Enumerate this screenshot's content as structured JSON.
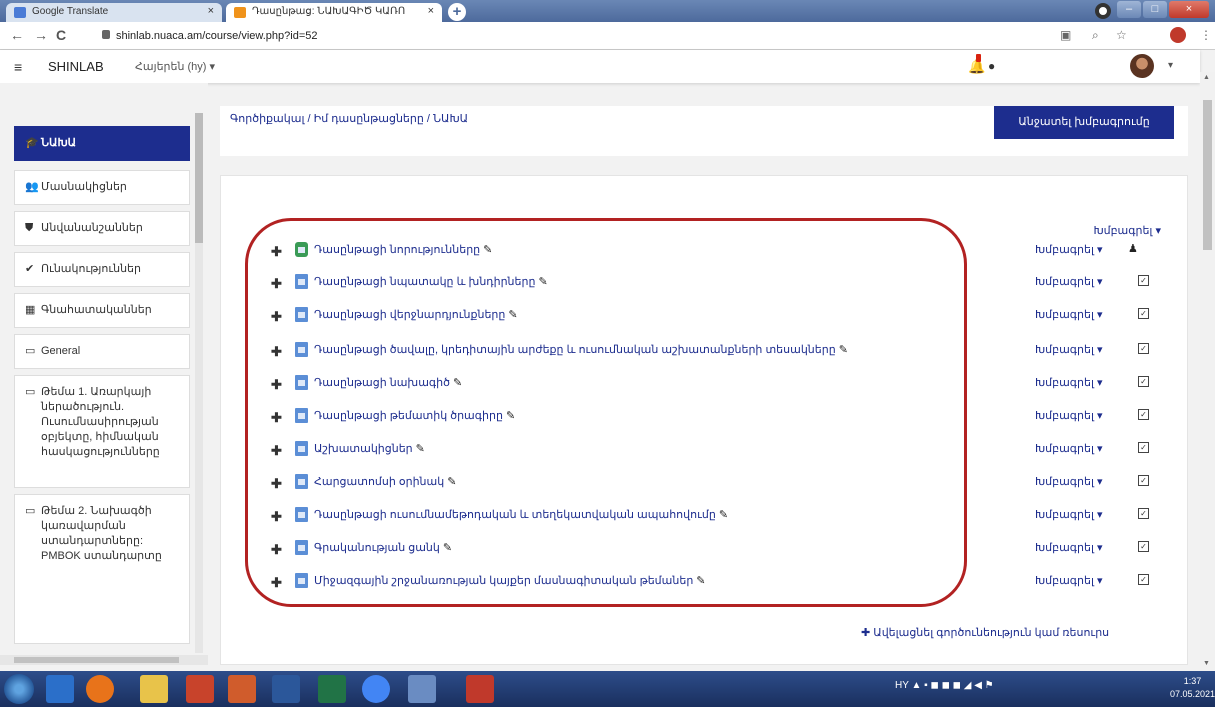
{
  "browser": {
    "tabs": [
      {
        "label": "Google Translate",
        "close": "×",
        "favicon_color": "#4a7bd6"
      },
      {
        "label": "Դասընթաց: ՆԱԽԱԳԻԾ ԿԱՌՈ",
        "close": "×",
        "favicon_color": "#f0931b"
      }
    ],
    "new_tab": "+",
    "window_buttons": [
      "–",
      "□",
      "×"
    ],
    "url": "shinlab.nuaca.am/course/view.php?id=52",
    "nav": {
      "back": "←",
      "forward": "→",
      "reload": "C"
    }
  },
  "navbar": {
    "brand": "SHINLAB",
    "language": "Հայերեն (hy) ▾",
    "menu_icon": "≡",
    "avatar_caret": "▾"
  },
  "drawer": {
    "items": [
      {
        "icon": "graduation-cap-icon",
        "glyph": "🎓",
        "label": "ՆԱԽԱ",
        "active": true
      },
      {
        "icon": "users-icon",
        "glyph": "👥",
        "label": "Մասնակիցներ"
      },
      {
        "icon": "shield-icon",
        "glyph": "⛊",
        "label": "Անվանանշաններ"
      },
      {
        "icon": "check-icon",
        "glyph": "✔",
        "label": "Ունակություններ"
      },
      {
        "icon": "grades-icon",
        "glyph": "▦",
        "label": "Գնահատականներ"
      },
      {
        "icon": "folder-icon",
        "glyph": "▭",
        "label": "General"
      },
      {
        "icon": "folder-icon",
        "glyph": "▭",
        "label": "Թեմա 1. Առարկայի ներածություն. Ուսումնասիրության օբյեկտը, հիմնական հասկացությունները"
      },
      {
        "icon": "folder-icon",
        "glyph": "▭",
        "label": "Թեմա 2. Նախագծի կառավարման ստանդարտները: PMBOK ստանդարտը"
      }
    ]
  },
  "breadcrumb": "Գործիքակալ / Իմ դասընթացները / ՆԱԽԱ",
  "edit_button": "Անջատել խմբագրումը",
  "section_edit": "Խմբագրել ▾",
  "activities": [
    {
      "type": "forum",
      "name": "Դասընթացի նորությունները",
      "edit": "Խմբագրել ▾",
      "extra": "user"
    },
    {
      "type": "page",
      "name": "Դասընթացի նպատակը և խնդիրները",
      "edit": "Խմբագրել ▾"
    },
    {
      "type": "page",
      "name": "Դասընթացի վերջնարդյունքները",
      "edit": "Խմբագրել ▾"
    },
    {
      "type": "page",
      "name": "Դասընթացի ծավալը, կրեդիտային արժեքը և ուսումնական աշխատանքների տեսակները",
      "edit": "Խմբագրել ▾"
    },
    {
      "type": "page",
      "name": "Դասընթացի նախագիծ",
      "edit": "Խմբագրել ▾"
    },
    {
      "type": "page",
      "name": "Դասընթացի թեմատիկ ծրագիրը",
      "edit": "Խմբագրել ▾"
    },
    {
      "type": "page",
      "name": "Աշխատակիցներ",
      "edit": "Խմբագրել ▾"
    },
    {
      "type": "page",
      "name": "Հարցատոմսի օրինակ",
      "edit": "Խմբագրել ▾"
    },
    {
      "type": "page",
      "name": "Դասընթացի ուսումնամեթոդական և տեղեկատվական ապահովումը",
      "edit": "Խմբագրել ▾"
    },
    {
      "type": "page",
      "name": "Գրականության ցանկ",
      "edit": "Խմբագրել ▾"
    },
    {
      "type": "page",
      "name": "Միջազգային շրջանառության կայքեր մասնագիտական թեմաներ",
      "edit": "Խմբագրել ▾"
    }
  ],
  "add_activity": "✚ Ավելացնել գործունեություն կամ ռեսուրս",
  "taskbar": {
    "tray_lang": "HY",
    "time": "1:37",
    "date": "07.05.2021"
  }
}
